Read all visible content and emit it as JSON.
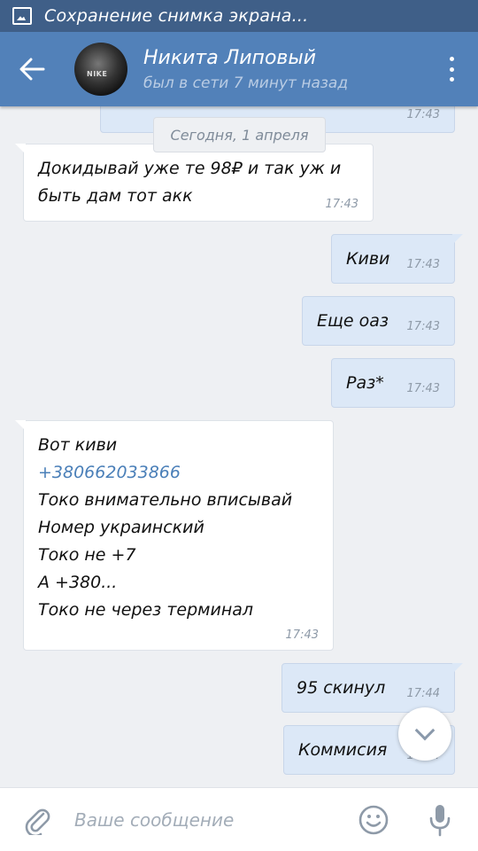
{
  "statusbar": {
    "title": "Сохранение снимка экрана..."
  },
  "header": {
    "name": "Никита Липовый",
    "status": "был в сети 7 минут назад"
  },
  "chat": {
    "date_separator": "Сегодня, 1 апреля",
    "messages": [
      {
        "direction": "out",
        "text": "",
        "time": "17:43"
      },
      {
        "direction": "in",
        "text": "Докидывай уже те 98₽ и так уж и\nбыть дам тот акк",
        "time": "17:43"
      },
      {
        "direction": "out",
        "text": "Киви",
        "time": "17:43"
      },
      {
        "direction": "out",
        "text": "Еще оаз",
        "time": "17:43"
      },
      {
        "direction": "out",
        "text": "Раз*",
        "time": "17:43"
      },
      {
        "direction": "in",
        "line1": "Вот киви",
        "phone": "+380662033866",
        "rest": "Токо внимательно вписывай\nНомер украинский\nТоко не +7\nА +380...\nТоко не через терминал",
        "time": "17:43"
      },
      {
        "direction": "out",
        "text": "95 скинул",
        "time": "17:44"
      },
      {
        "direction": "out",
        "text": "Коммисия",
        "time": "17:44"
      }
    ]
  },
  "composer": {
    "placeholder": "Ваше сообщение"
  },
  "colors": {
    "header": "#5281b9",
    "statusbar": "#3f5f88",
    "outgoing": "#dce8f7",
    "incoming": "#ffffff",
    "link": "#4a7fb8"
  },
  "icons": [
    "screenshot-icon",
    "back-arrow-icon",
    "more-vertical-icon",
    "chevron-down-icon",
    "paperclip-icon",
    "emoji-icon",
    "microphone-icon"
  ]
}
